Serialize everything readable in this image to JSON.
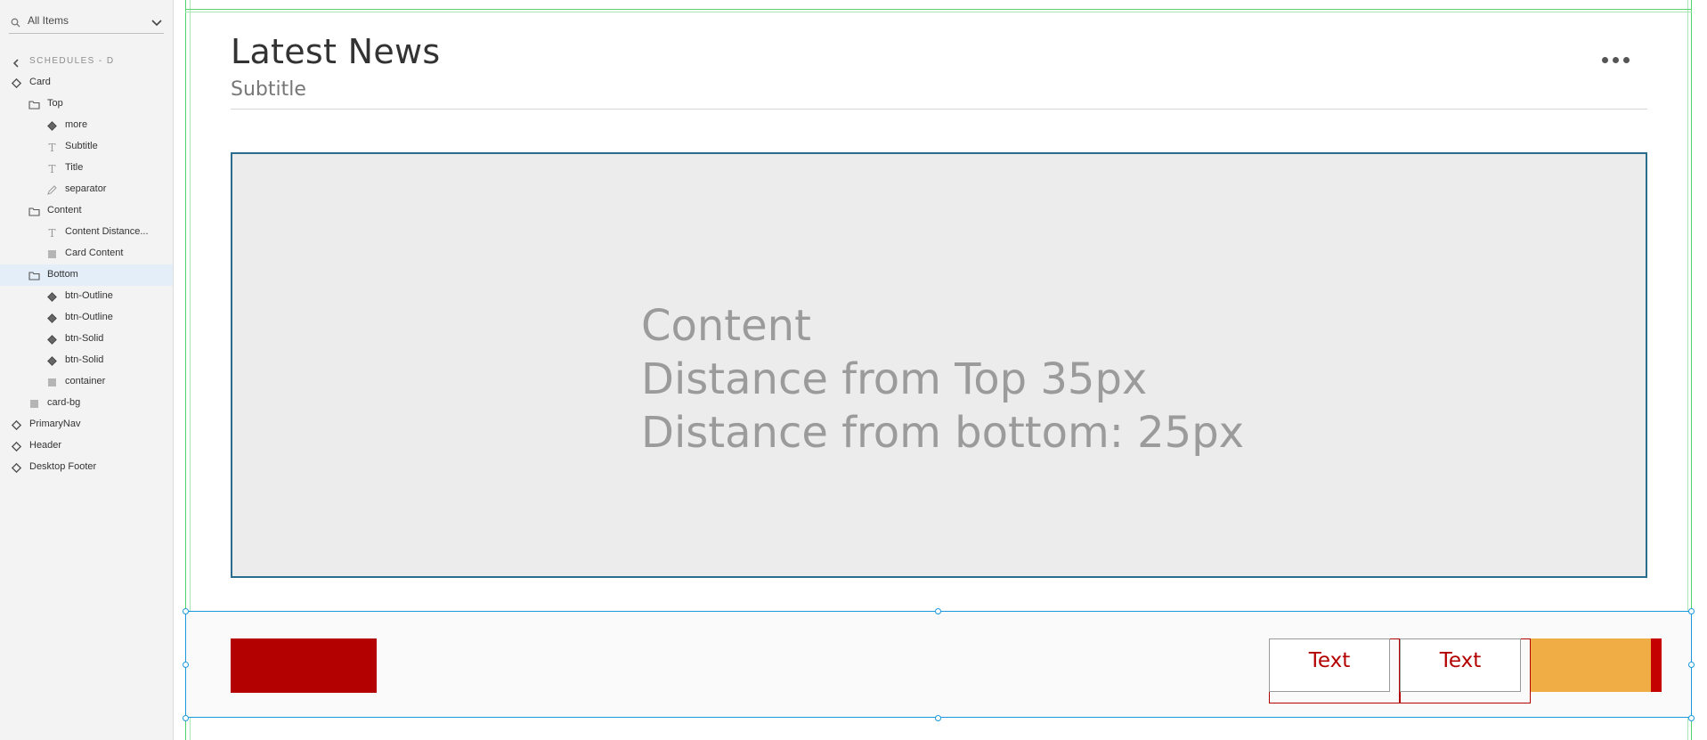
{
  "search": {
    "label": "All Items"
  },
  "breadcrumb": {
    "label": "SCHEDULES - D"
  },
  "layers": [
    {
      "label": "Card",
      "icon": "component-icon"
    },
    {
      "label": "Top",
      "icon": "folder-icon"
    },
    {
      "label": "more",
      "icon": "component-icon"
    },
    {
      "label": "Subtitle",
      "icon": "text-icon"
    },
    {
      "label": "Title",
      "icon": "text-icon"
    },
    {
      "label": "separator",
      "icon": "pen-icon"
    },
    {
      "label": "Content",
      "icon": "folder-icon"
    },
    {
      "label": "Content Distance...",
      "icon": "text-icon"
    },
    {
      "label": "Card Content",
      "icon": "rectangle-icon"
    },
    {
      "label": "Bottom",
      "icon": "folder-icon",
      "selected": true
    },
    {
      "label": "btn-Outline",
      "icon": "component-icon"
    },
    {
      "label": "btn-Outline",
      "icon": "component-icon"
    },
    {
      "label": "btn-Solid",
      "icon": "component-icon"
    },
    {
      "label": "btn-Solid",
      "icon": "component-icon"
    },
    {
      "label": "container",
      "icon": "rectangle-icon"
    },
    {
      "label": "card-bg",
      "icon": "rectangle-icon"
    },
    {
      "label": "PrimaryNav",
      "icon": "component-icon"
    },
    {
      "label": "Header",
      "icon": "component-icon"
    },
    {
      "label": "Desktop Footer",
      "icon": "component-icon"
    }
  ],
  "card": {
    "title": "Latest News",
    "subtitle": "Subtitle",
    "content_lines": [
      "Content",
      "Distance from Top 35px",
      "Distance from bottom: 25px"
    ],
    "buttons": {
      "outline_1": "Text",
      "outline_2": "Text"
    }
  },
  "colors": {
    "accent_red": "#b30000",
    "accent_orange": "#f1ad45",
    "selection_blue": "#1c98dc",
    "guide_green": "#4cd46a",
    "content_border": "#2a6d8f"
  }
}
